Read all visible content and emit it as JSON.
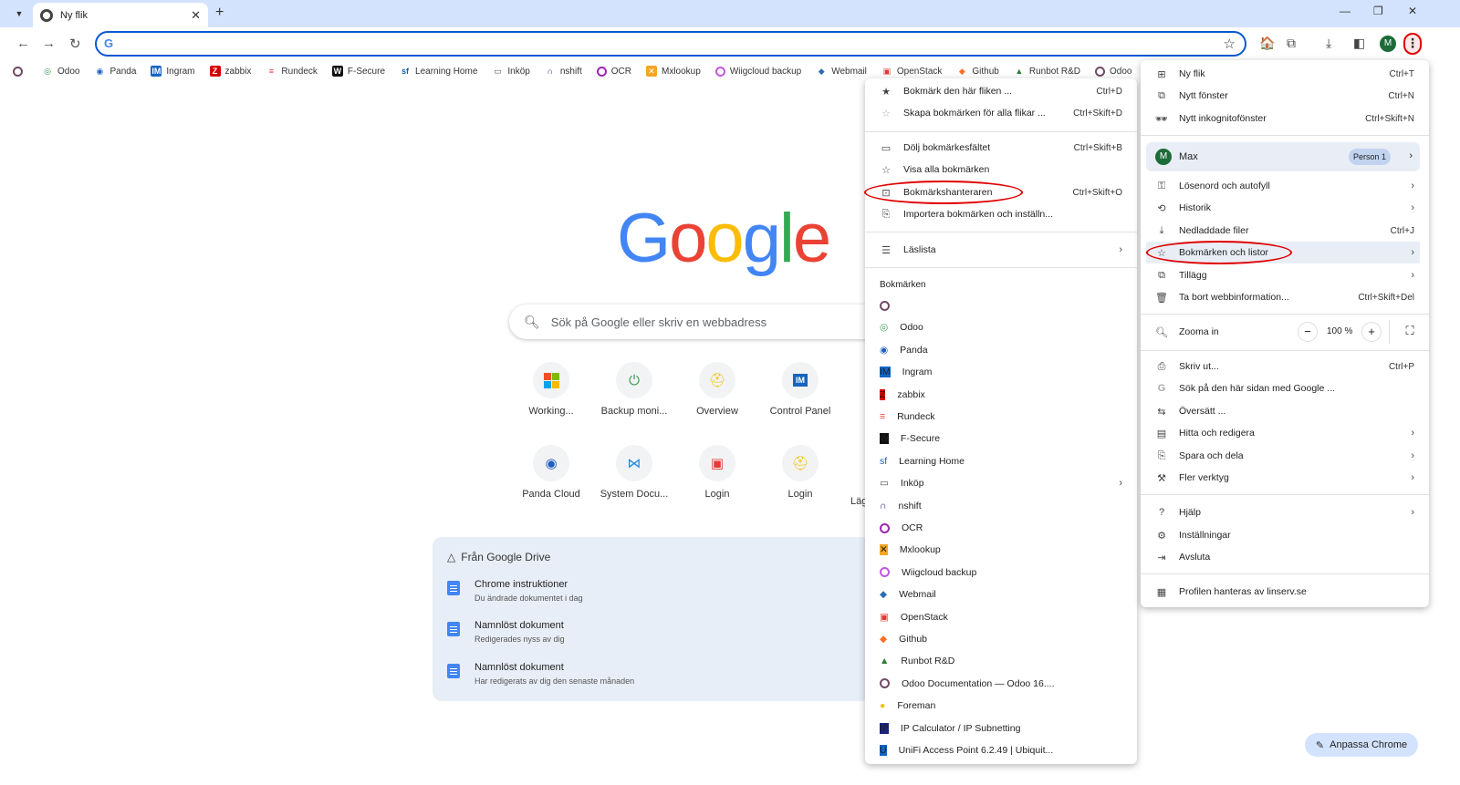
{
  "tab": {
    "title": "Ny flik"
  },
  "ntp": {
    "search_placeholder": "Sök på Google eller skriv en webbadress",
    "shortcuts": [
      {
        "label": "Working..."
      },
      {
        "label": "Backup moni..."
      },
      {
        "label": "Overview"
      },
      {
        "label": "Control Panel"
      },
      {
        "label": "Panda Cloud"
      },
      {
        "label": "System Docu..."
      },
      {
        "label": "Login"
      },
      {
        "label": "Login"
      },
      {
        "label": "Läg"
      }
    ],
    "drive": {
      "title": "Från Google Drive",
      "items": [
        {
          "name": "Chrome instruktioner",
          "meta": "Du ändrade dokumentet i dag"
        },
        {
          "name": "Namnlöst dokument",
          "meta": "Redigerades nyss av dig"
        },
        {
          "name": "Namnlöst dokument",
          "meta": "Har redigerats av dig den senaste månaden"
        }
      ]
    },
    "customize": "Anpassa Chrome"
  },
  "bookmarks_bar": [
    {
      "label": "",
      "icon": "odoo-ring-icon"
    },
    {
      "label": "Odoo",
      "icon": "odoo-icon"
    },
    {
      "label": "Panda",
      "icon": "panda-icon"
    },
    {
      "label": "Ingram",
      "icon": "ingram-icon"
    },
    {
      "label": "zabbix",
      "icon": "zabbix-icon"
    },
    {
      "label": "Rundeck",
      "icon": "rundeck-icon"
    },
    {
      "label": "F-Secure",
      "icon": "fsecure-icon"
    },
    {
      "label": "Learning Home",
      "icon": "sf-icon"
    },
    {
      "label": "Inköp",
      "icon": "folder-icon"
    },
    {
      "label": "nshift",
      "icon": "nshift-icon"
    },
    {
      "label": "OCR",
      "icon": "ocr-icon"
    },
    {
      "label": "Mxlookup",
      "icon": "mxlookup-icon"
    },
    {
      "label": "Wiigcloud backup",
      "icon": "wiigcloud-icon"
    },
    {
      "label": "Webmail",
      "icon": "webmail-icon"
    },
    {
      "label": "OpenStack",
      "icon": "openstack-icon"
    },
    {
      "label": "Github",
      "icon": "gitlab-icon"
    },
    {
      "label": "Runbot R&D",
      "icon": "runbot-icon"
    },
    {
      "label": "Odoo",
      "icon": "odoo-ring-icon"
    }
  ],
  "submenu": {
    "top_items": [
      {
        "label": "Bokmärk den här fliken ...",
        "shortcut": "Ctrl+D",
        "icon": "star-icon"
      },
      {
        "label": "Skapa bokmärken för alla flikar ...",
        "shortcut": "Ctrl+Skift+D",
        "icon": "star-icon"
      },
      {
        "label": "Dölj bokmärkesfältet",
        "shortcut": "Ctrl+Skift+B",
        "icon": "bookmark-bar-icon"
      },
      {
        "label": "Visa alla bokmärken",
        "shortcut": "",
        "icon": "star-icon"
      },
      {
        "label": "Bokmärkshanteraren",
        "shortcut": "Ctrl+Skift+O",
        "icon": "bookmark-manager-icon"
      },
      {
        "label": "Importera bokmärken och inställn...",
        "shortcut": "",
        "icon": "import-icon"
      },
      {
        "label": "Läslista",
        "shortcut": "",
        "icon": "reading-list-icon"
      }
    ],
    "section_label": "Bokmärken",
    "bookmarks": [
      {
        "label": ""
      },
      {
        "label": "Odoo"
      },
      {
        "label": "Panda"
      },
      {
        "label": "Ingram"
      },
      {
        "label": "zabbix"
      },
      {
        "label": "Rundeck"
      },
      {
        "label": "F-Secure"
      },
      {
        "label": "Learning Home"
      },
      {
        "label": "Inköp"
      },
      {
        "label": "nshift"
      },
      {
        "label": "OCR"
      },
      {
        "label": "Mxlookup"
      },
      {
        "label": "Wiigcloud backup"
      },
      {
        "label": "Webmail"
      },
      {
        "label": "OpenStack"
      },
      {
        "label": "Github"
      },
      {
        "label": "Runbot R&D"
      },
      {
        "label": "Odoo Documentation — Odoo 16...."
      },
      {
        "label": "Foreman"
      },
      {
        "label": "IP Calculator / IP Subnetting"
      },
      {
        "label": "UniFi Access Point 6.2.49 | Ubiquit..."
      }
    ]
  },
  "mainmenu": {
    "new_tab": {
      "label": "Ny flik",
      "shortcut": "Ctrl+T"
    },
    "new_window": {
      "label": "Nytt fönster",
      "shortcut": "Ctrl+N"
    },
    "incognito": {
      "label": "Nytt inkognitofönster",
      "shortcut": "Ctrl+Skift+N"
    },
    "profile": {
      "name": "Max",
      "badge": "Person 1",
      "initial": "M"
    },
    "passwords": {
      "label": "Lösenord och autofyll"
    },
    "history": {
      "label": "Historik"
    },
    "downloads": {
      "label": "Nedladdade filer",
      "shortcut": "Ctrl+J"
    },
    "bookmarks": {
      "label": "Bokmärken och listor"
    },
    "extensions": {
      "label": "Tillägg"
    },
    "clear": {
      "label": "Ta bort webbinformation...",
      "shortcut": "Ctrl+Skift+Del"
    },
    "zoom": {
      "label": "Zooma in",
      "value": "100 %"
    },
    "print": {
      "label": "Skriv ut...",
      "shortcut": "Ctrl+P"
    },
    "search_page": {
      "label": "Sök på den här sidan med Google ..."
    },
    "translate": {
      "label": "Översätt ..."
    },
    "find": {
      "label": "Hitta och redigera"
    },
    "save_share": {
      "label": "Spara och dela"
    },
    "more_tools": {
      "label": "Fler verktyg"
    },
    "help": {
      "label": "Hjälp"
    },
    "settings": {
      "label": "Inställningar"
    },
    "exit": {
      "label": "Avsluta"
    },
    "managed": {
      "label": "Profilen hanteras av linserv.se"
    }
  },
  "colors": {
    "accent": "#0b57d0",
    "annotation_red": "#e00000",
    "tabstrip": "#d3e3fd"
  }
}
